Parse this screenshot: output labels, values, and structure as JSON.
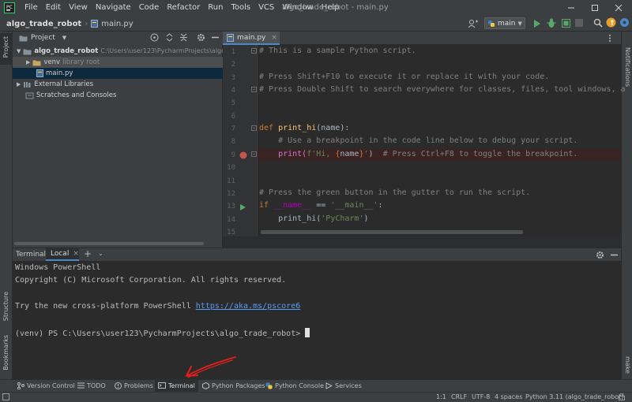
{
  "window": {
    "title": "algo_trade_robot - main.py",
    "menu": [
      "File",
      "Edit",
      "View",
      "Navigate",
      "Code",
      "Refactor",
      "Run",
      "Tools",
      "VCS",
      "Window",
      "Help"
    ]
  },
  "navbar": {
    "project": "algo_trade_robot",
    "file": "main.py",
    "run_config": "main"
  },
  "project_panel": {
    "title": "Project",
    "tree": {
      "root_name": "algo_trade_robot",
      "root_path": "C:\\Users\\user123\\PycharmProjects\\algo_trade",
      "venv_name": "venv",
      "venv_hint": "library root",
      "main_file": "main.py",
      "external_libraries": "External Libraries",
      "scratches": "Scratches and Consoles"
    }
  },
  "editor": {
    "tab": "main.py",
    "line_numbers": [
      "1",
      "2",
      "3",
      "4",
      "5",
      "6",
      "7",
      "8",
      "9",
      "10",
      "11",
      "12",
      "13",
      "14",
      "15"
    ],
    "lines": {
      "l1": "# This is a sample Python script.",
      "l3": "# Press Shift+F10 to execute it or replace it with your code.",
      "l4": "# Press Double Shift to search everywhere for classes, files, tool windows, a",
      "l7_kw": "def ",
      "l7_fn": "print_hi",
      "l7_rest": "(name):",
      "l8": "    # Use a breakpoint in the code line below to debug your script.",
      "l9_a": "    print(",
      "l9_str1": "f'Hi, ",
      "l9_brace1": "{",
      "l9_var": "name",
      "l9_brace2": "}",
      "l9_str2": "'",
      "l9_b": ")  ",
      "l9_cmt": "# Press Ctrl+F8 to toggle the breakpoint.",
      "l12": "# Press the green button in the gutter to run the script.",
      "l13_kw": "if ",
      "l13_dunder": "__name__",
      "l13_mid": " == ",
      "l13_str": "'__main__'",
      "l13_end": ":",
      "l14_a": "    print_hi(",
      "l14_str": "'PyCharm'",
      "l14_b": ")"
    }
  },
  "terminal": {
    "label": "Terminal:",
    "tab": "Local",
    "lines": {
      "t1": "Windows PowerShell",
      "t2": "Copyright (C) Microsoft Corporation. All rights reserved.",
      "t4_a": "Try the new cross-platform PowerShell ",
      "t4_link": "https://aka.ms/pscore6",
      "t6": "(venv) PS C:\\Users\\user123\\PycharmProjects\\algo_trade_robot> "
    }
  },
  "side_labels": {
    "project": "Project",
    "structure": "Structure",
    "bookmarks": "Bookmarks",
    "notifications": "Notifications",
    "make": "make"
  },
  "tool_windows": {
    "version_control": "Version Control",
    "todo": "TODO",
    "problems": "Problems",
    "terminal": "Terminal",
    "python_packages": "Python Packages",
    "python_console": "Python Console",
    "services": "Services"
  },
  "status": {
    "position": "1:1",
    "line_sep": "CRLF",
    "encoding": "UTF-8",
    "indent": "4 spaces",
    "interpreter": "Python 3.11 (algo_trade_robot)"
  },
  "colors": {
    "accent": "#4a88c7",
    "run_green": "#59a869",
    "breakpoint_red": "#c75450",
    "annotation_arrow": "#e0201a"
  }
}
